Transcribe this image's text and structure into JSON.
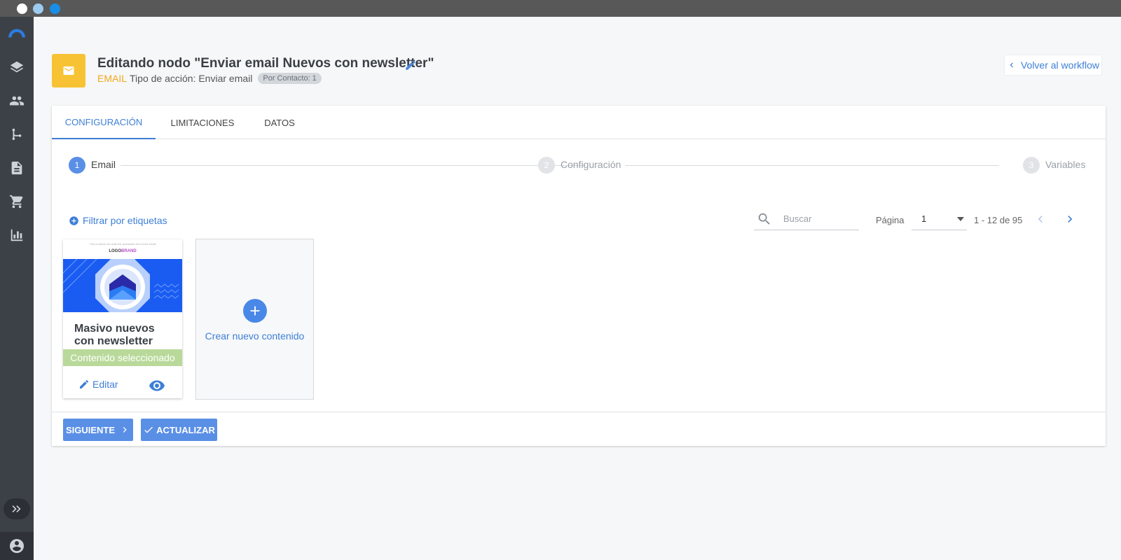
{
  "window": {
    "dot_colors": [
      "#ffffff",
      "#9ccbf2",
      "#1a8ee6"
    ]
  },
  "sidebar": {
    "items": [
      {
        "icon": "logo-icon"
      },
      {
        "icon": "layers-icon"
      },
      {
        "icon": "people-icon"
      },
      {
        "icon": "workflow-icon"
      },
      {
        "icon": "document-icon"
      },
      {
        "icon": "cart-icon"
      },
      {
        "icon": "chart-icon"
      }
    ],
    "expand_icon": "double-chevron-right-icon",
    "user_icon": "account-circle-icon"
  },
  "header": {
    "title": "Editando nodo \"Enviar email Nuevos con newsletter\"",
    "type_label": "EMAIL",
    "action_type": "Tipo de acción: Enviar email",
    "badge": "Por Contacto: 1",
    "back_label": "Volver al workflow",
    "accent_color": "#f7c234"
  },
  "tabs": [
    {
      "label": "CONFIGURACIÓN",
      "active": true
    },
    {
      "label": "LIMITACIONES",
      "active": false
    },
    {
      "label": "DATOS",
      "active": false
    }
  ],
  "stepper": [
    {
      "number": "1",
      "label": "Email",
      "active": true
    },
    {
      "number": "2",
      "label": "Configuración",
      "active": false
    },
    {
      "number": "3",
      "label": "Variables",
      "active": false
    }
  ],
  "toolbar": {
    "filter_label": "Filtrar por etiquetas",
    "search_placeholder": "Buscar",
    "page_label": "Página",
    "page_value": "1",
    "range": "1 - 12 de 95"
  },
  "templates": [
    {
      "title": "Masivo nuevos con newsletter",
      "thumb_top_text": "This is where we write the preheader text of the email",
      "logo_part1": "LOGO",
      "logo_part2": "BRAND",
      "selected_label": "Contenido seleccionado",
      "edit_label": "Editar"
    }
  ],
  "new_content_label": "Crear nuevo contenido",
  "footer": {
    "next_label": "SIGUIENTE",
    "update_label": "ACTUALIZAR"
  },
  "colors": {
    "primary": "#3d7fd6",
    "selected": "#b9d99a",
    "sidebar": "#3c4148"
  }
}
